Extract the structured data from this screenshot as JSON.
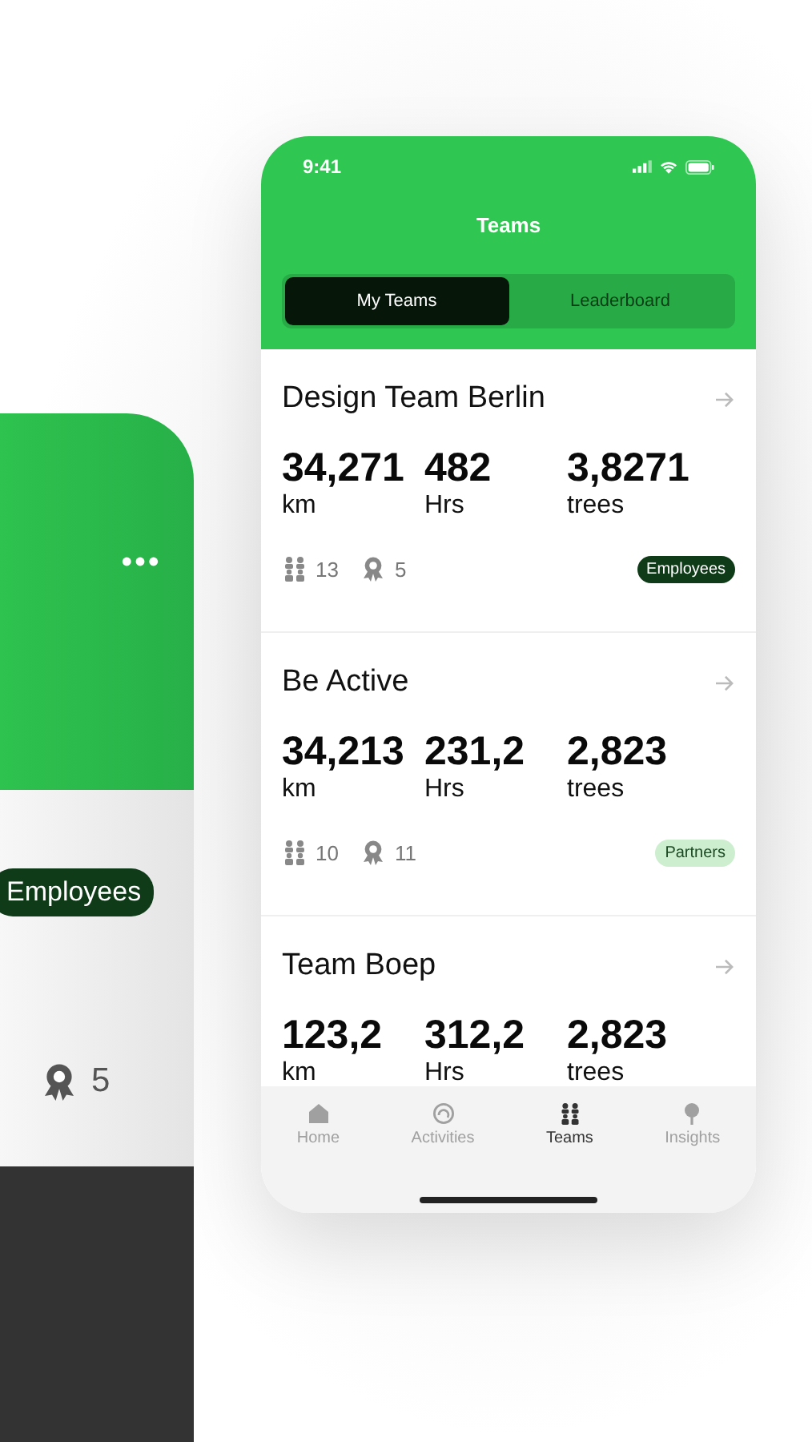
{
  "background_phone": {
    "tag": {
      "label": "Employees",
      "kind": "employees"
    },
    "awards": "5"
  },
  "phone": {
    "status_bar": {
      "time": "9:41"
    },
    "title": "Teams",
    "tabs": [
      {
        "label": "My Teams",
        "selected": true
      },
      {
        "label": "Leaderboard",
        "selected": false
      }
    ],
    "teams": [
      {
        "name": "Design Team Berlin",
        "stats": [
          {
            "value": "34,271",
            "unit": "km"
          },
          {
            "value": "482",
            "unit": "Hrs"
          },
          {
            "value": "3,8271",
            "unit": "trees"
          }
        ],
        "members": "13",
        "awards": "5",
        "tag": {
          "label": "Employees",
          "kind": "employees"
        }
      },
      {
        "name": "Be Active",
        "stats": [
          {
            "value": "34,213",
            "unit": "km"
          },
          {
            "value": "231,2",
            "unit": "Hrs"
          },
          {
            "value": "2,823",
            "unit": "trees"
          }
        ],
        "members": "10",
        "awards": "11",
        "tag": {
          "label": "Partners",
          "kind": "partners"
        }
      },
      {
        "name": "Team Boep",
        "stats": [
          {
            "value": "123,2",
            "unit": "km"
          },
          {
            "value": "312,2",
            "unit": "Hrs"
          },
          {
            "value": "2,823",
            "unit": "trees"
          }
        ]
      }
    ],
    "nav": [
      {
        "label": "Home",
        "kind": "home",
        "selected": false
      },
      {
        "label": "Activities",
        "kind": "activities",
        "selected": false
      },
      {
        "label": "Teams",
        "kind": "teams",
        "selected": true
      },
      {
        "label": "Insights",
        "kind": "insights",
        "selected": false
      }
    ]
  }
}
